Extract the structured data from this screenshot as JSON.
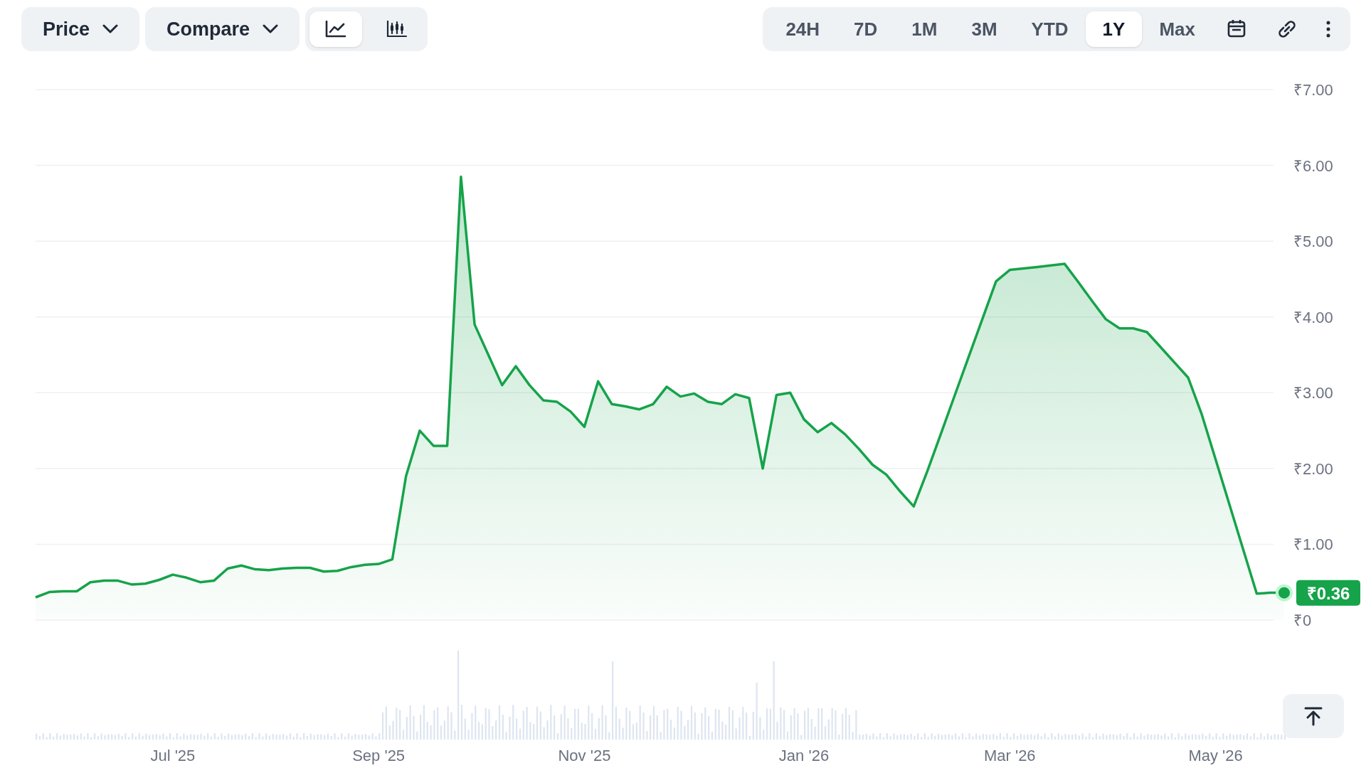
{
  "toolbar": {
    "dropdowns": [
      {
        "label": "Price"
      },
      {
        "label": "Compare"
      }
    ],
    "chart_types": [
      {
        "kind": "line",
        "selected": true
      },
      {
        "kind": "candlestick",
        "selected": false
      }
    ],
    "ranges": [
      {
        "label": "24H",
        "selected": false
      },
      {
        "label": "7D",
        "selected": false
      },
      {
        "label": "1M",
        "selected": false
      },
      {
        "label": "3M",
        "selected": false
      },
      {
        "label": "YTD",
        "selected": false
      },
      {
        "label": "1Y",
        "selected": true
      },
      {
        "label": "Max",
        "selected": false
      }
    ]
  },
  "chart": {
    "chart_data": {
      "type": "area",
      "ylim": [
        0,
        7
      ],
      "categories": [
        null,
        null,
        null,
        null,
        null,
        null,
        null,
        null,
        null,
        null,
        "Jul '25",
        null,
        null,
        null,
        null,
        null,
        null,
        null,
        null,
        null,
        null,
        null,
        null,
        null,
        null,
        "Sep '25",
        null,
        null,
        null,
        null,
        null,
        null,
        null,
        null,
        null,
        null,
        null,
        null,
        null,
        null,
        "Nov '25",
        null,
        null,
        null,
        null,
        null,
        null,
        null,
        null,
        null,
        null,
        null,
        null,
        null,
        null,
        null,
        "Jan '26",
        null,
        null,
        null,
        null,
        null,
        null,
        null,
        null,
        null,
        null,
        null,
        null,
        null,
        null,
        "Mar '26",
        null,
        null,
        null,
        null,
        null,
        null,
        null,
        null,
        null,
        null,
        null,
        null,
        null,
        null,
        "May '26",
        null,
        null,
        null,
        null,
        null
      ],
      "yticks": [
        {
          "value": 0,
          "label": "₹0"
        },
        {
          "value": 1,
          "label": "₹1.00"
        },
        {
          "value": 2,
          "label": "₹2.00"
        },
        {
          "value": 3,
          "label": "₹3.00"
        },
        {
          "value": 4,
          "label": "₹4.00"
        },
        {
          "value": 5,
          "label": "₹5.00"
        },
        {
          "value": 6,
          "label": "₹6.00"
        },
        {
          "value": 7,
          "label": "₹7.00"
        }
      ],
      "series": [
        {
          "color": "#16a34a",
          "values": [
            0.3,
            0.37,
            0.38,
            0.38,
            0.5,
            0.52,
            0.52,
            0.47,
            0.48,
            0.53,
            0.6,
            0.56,
            0.5,
            0.52,
            0.68,
            0.72,
            0.67,
            0.66,
            0.68,
            0.69,
            0.69,
            0.64,
            0.65,
            0.7,
            0.73,
            0.74,
            0.8,
            1.9,
            2.5,
            2.3,
            2.3,
            5.85,
            3.9,
            3.5,
            3.1,
            3.35,
            3.1,
            2.9,
            2.88,
            2.75,
            2.55,
            3.15,
            2.85,
            2.82,
            2.78,
            2.85,
            3.08,
            2.95,
            2.99,
            2.88,
            2.85,
            2.98,
            2.93,
            2.0,
            2.97,
            3.0,
            2.65,
            2.48,
            2.6,
            2.45,
            2.26,
            2.05,
            1.92,
            1.7,
            1.5,
            1.97,
            2.47,
            2.97,
            3.47,
            3.97,
            4.47,
            4.62,
            4.64,
            4.66,
            4.68,
            4.7,
            4.46,
            4.21,
            3.97,
            3.85,
            3.85,
            3.8,
            3.6,
            3.4,
            3.2,
            2.71,
            2.12,
            1.53,
            0.94,
            0.35,
            0.36,
            0.36
          ]
        }
      ],
      "annotations": [
        "₹0.36"
      ],
      "grid": true
    }
  }
}
